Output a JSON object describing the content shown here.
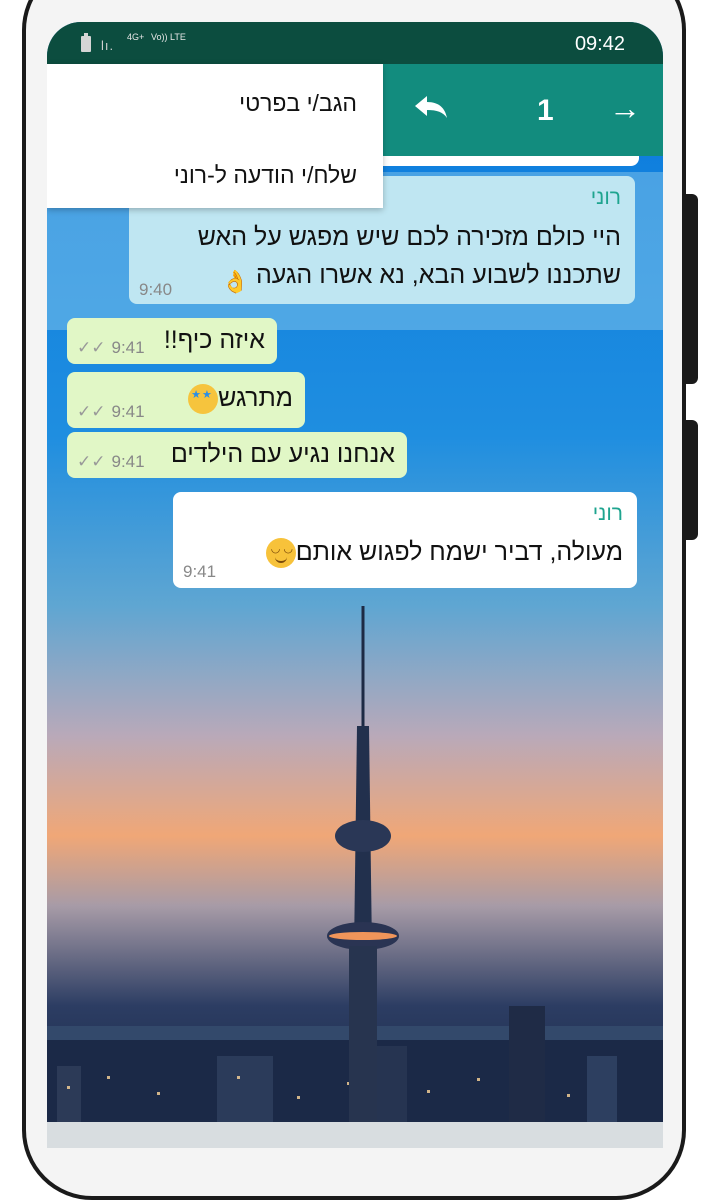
{
  "status_bar": {
    "time": "09:42",
    "network": "4G+",
    "volte": "Vo)) LTE",
    "signal": "lı."
  },
  "toolbar": {
    "selected_count": "1",
    "forward_icon": "arrow-right-icon",
    "reply_icon": "reply-icon"
  },
  "menu": {
    "items": [
      {
        "label": "הגב/י בפרטי"
      },
      {
        "label": "שלח/י הודעה ל-רוני"
      }
    ]
  },
  "messages": [
    {
      "type": "incoming",
      "sender": "רוני",
      "text": "היי כולם מזכירה לכם שיש מפגש על האש שתכננו לשבוע הבא, נא אשרו הגעה",
      "time": "9:40",
      "emoji": "ok-hand"
    },
    {
      "type": "outgoing",
      "text": "איזה כיף!!",
      "time": "9:41"
    },
    {
      "type": "outgoing",
      "text": "מתרגש",
      "time": "9:41",
      "emoji": "star-struck"
    },
    {
      "type": "outgoing",
      "text": "אנחנו נגיע עם הילדים",
      "time": "9:41"
    },
    {
      "type": "incoming",
      "sender": "רוני",
      "text": "מעולה, דביר ישמח לפגוש אותם",
      "time": "9:41",
      "emoji": "smiling-face"
    }
  ],
  "colors": {
    "header": "#128c7e",
    "status": "#0c4d3f",
    "outgoing": "#e1f7c6",
    "incoming": "#ffffff",
    "sender": "#1ea48f"
  }
}
